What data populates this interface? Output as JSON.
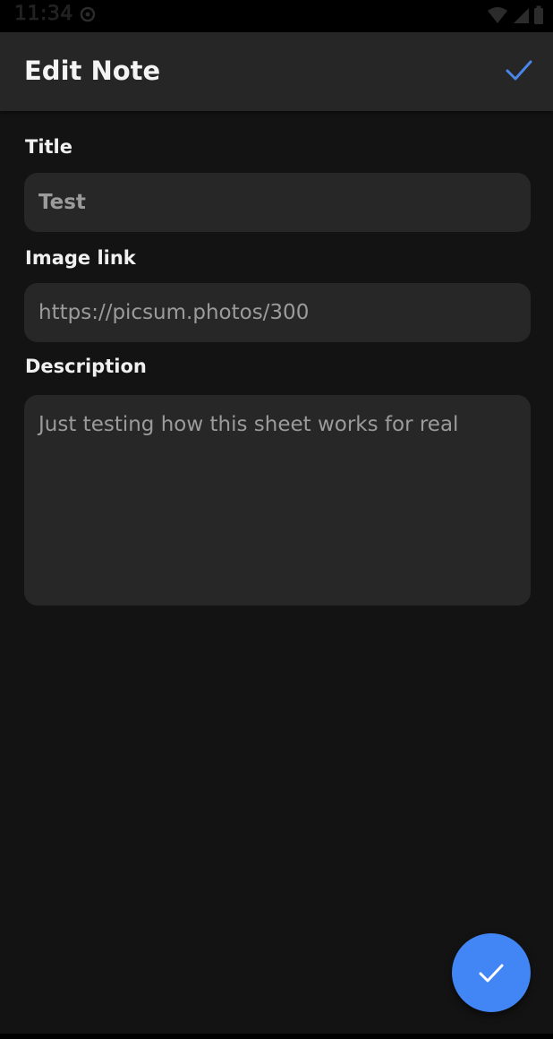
{
  "status_bar": {
    "time": "11:34",
    "icons": [
      "sync-icon",
      "wifi-icon",
      "signal-icon",
      "battery-icon"
    ]
  },
  "app_bar": {
    "title": "Edit Note",
    "confirm_icon": "check-icon"
  },
  "form": {
    "title_label": "Title",
    "title_value": "Test",
    "image_label": "Image link",
    "image_value": "https://picsum.photos/300",
    "description_label": "Description",
    "description_value": "Just testing how this sheet works for real"
  },
  "fab": {
    "icon": "check-icon"
  },
  "colors": {
    "background": "#131314",
    "app_bar": "#262627",
    "field": "#272728",
    "accent": "#4285f4",
    "field_text": "#9b9b9b"
  }
}
